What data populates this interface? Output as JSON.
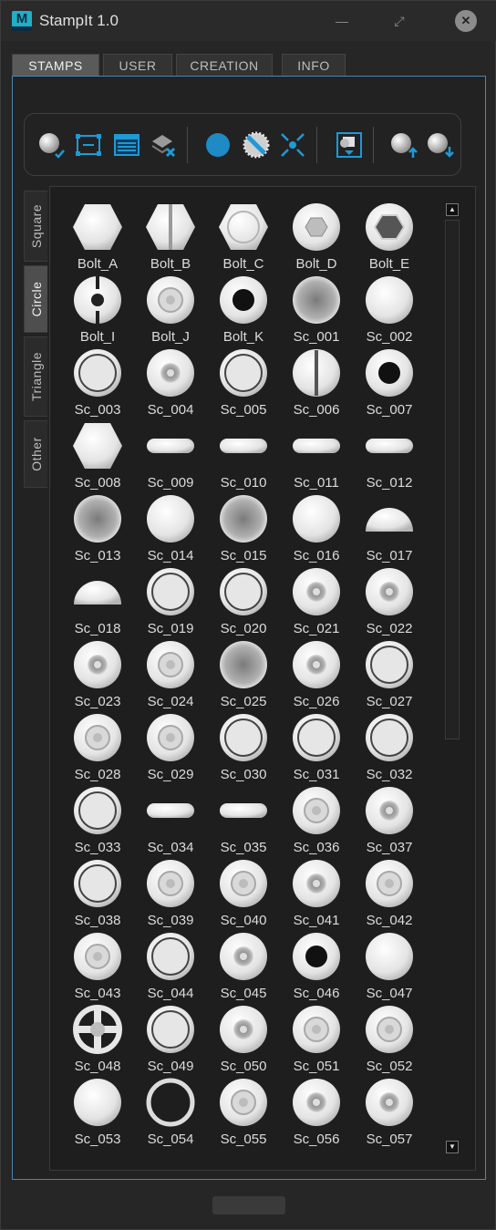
{
  "window": {
    "logo_letter": "M",
    "title": "StampIt 1.0",
    "minimize_glyph": "—",
    "maximize_glyph": "⤢",
    "close_glyph": "✕"
  },
  "tabs": [
    {
      "label": "STAMPS",
      "active": true
    },
    {
      "label": "USER",
      "active": false
    },
    {
      "label": "CREATION",
      "active": false
    },
    {
      "label": "INFO",
      "active": false
    }
  ],
  "toolbar": {
    "accent": "#1e9ad6",
    "icons": [
      "sphere-check-icon",
      "bounding-box-icon",
      "browser-window-icon",
      "layer-delete-icon",
      "circle-fill-icon",
      "circle-saw-icon",
      "cross-arrows-icon",
      "stamp-dropdown-icon",
      "sphere-up-icon",
      "sphere-down-icon"
    ]
  },
  "categories": [
    {
      "label": "Square",
      "active": false
    },
    {
      "label": "Circle",
      "active": true
    },
    {
      "label": "Triangle",
      "active": false
    },
    {
      "label": "Other",
      "active": false
    }
  ],
  "stamps": [
    {
      "name": "Bolt_A",
      "kind": "hex"
    },
    {
      "name": "Bolt_B",
      "kind": "hexslot"
    },
    {
      "name": "Bolt_C",
      "kind": "hexring"
    },
    {
      "name": "Bolt_D",
      "kind": "disc-hex"
    },
    {
      "name": "Bolt_E",
      "kind": "disc-hex-deep"
    },
    {
      "name": "Bolt_I",
      "kind": "disc-cut"
    },
    {
      "name": "Bolt_J",
      "kind": "disc-inner"
    },
    {
      "name": "Bolt_K",
      "kind": "disc-hole"
    },
    {
      "name": "Sc_001",
      "kind": "cup"
    },
    {
      "name": "Sc_002",
      "kind": "disc"
    },
    {
      "name": "Sc_003",
      "kind": "ring"
    },
    {
      "name": "Sc_004",
      "kind": "dimple"
    },
    {
      "name": "Sc_005",
      "kind": "ring"
    },
    {
      "name": "Sc_006",
      "kind": "slot"
    },
    {
      "name": "Sc_007",
      "kind": "disc-hole"
    },
    {
      "name": "Sc_008",
      "kind": "hex"
    },
    {
      "name": "Sc_009",
      "kind": "pill"
    },
    {
      "name": "Sc_010",
      "kind": "pill"
    },
    {
      "name": "Sc_011",
      "kind": "pill"
    },
    {
      "name": "Sc_012",
      "kind": "pill"
    },
    {
      "name": "Sc_013",
      "kind": "cup"
    },
    {
      "name": "Sc_014",
      "kind": "disc"
    },
    {
      "name": "Sc_015",
      "kind": "cup"
    },
    {
      "name": "Sc_016",
      "kind": "disc"
    },
    {
      "name": "Sc_017",
      "kind": "half"
    },
    {
      "name": "Sc_018",
      "kind": "half"
    },
    {
      "name": "Sc_019",
      "kind": "ring"
    },
    {
      "name": "Sc_020",
      "kind": "ring"
    },
    {
      "name": "Sc_021",
      "kind": "dimple"
    },
    {
      "name": "Sc_022",
      "kind": "dimple"
    },
    {
      "name": "Sc_023",
      "kind": "dimple"
    },
    {
      "name": "Sc_024",
      "kind": "disc-inner"
    },
    {
      "name": "Sc_025",
      "kind": "cup"
    },
    {
      "name": "Sc_026",
      "kind": "dimple"
    },
    {
      "name": "Sc_027",
      "kind": "ring"
    },
    {
      "name": "Sc_028",
      "kind": "disc-inner"
    },
    {
      "name": "Sc_029",
      "kind": "disc-inner"
    },
    {
      "name": "Sc_030",
      "kind": "ring"
    },
    {
      "name": "Sc_031",
      "kind": "ring"
    },
    {
      "name": "Sc_032",
      "kind": "ring"
    },
    {
      "name": "Sc_033",
      "kind": "ring"
    },
    {
      "name": "Sc_034",
      "kind": "pill"
    },
    {
      "name": "Sc_035",
      "kind": "pill"
    },
    {
      "name": "Sc_036",
      "kind": "disc-inner"
    },
    {
      "name": "Sc_037",
      "kind": "dimple"
    },
    {
      "name": "Sc_038",
      "kind": "ring"
    },
    {
      "name": "Sc_039",
      "kind": "disc-inner"
    },
    {
      "name": "Sc_040",
      "kind": "disc-inner"
    },
    {
      "name": "Sc_041",
      "kind": "dimple"
    },
    {
      "name": "Sc_042",
      "kind": "disc-inner"
    },
    {
      "name": "Sc_043",
      "kind": "disc-inner"
    },
    {
      "name": "Sc_044",
      "kind": "ring"
    },
    {
      "name": "Sc_045",
      "kind": "dimple"
    },
    {
      "name": "Sc_046",
      "kind": "disc-hole"
    },
    {
      "name": "Sc_047",
      "kind": "disc"
    },
    {
      "name": "Sc_048",
      "kind": "cross"
    },
    {
      "name": "Sc_049",
      "kind": "ring"
    },
    {
      "name": "Sc_050",
      "kind": "dimple"
    },
    {
      "name": "Sc_051",
      "kind": "disc-inner"
    },
    {
      "name": "Sc_052",
      "kind": "disc-inner"
    },
    {
      "name": "Sc_053",
      "kind": "disc"
    },
    {
      "name": "Sc_054",
      "kind": "ring-thin"
    },
    {
      "name": "Sc_055",
      "kind": "disc-inner"
    },
    {
      "name": "Sc_056",
      "kind": "dimple"
    },
    {
      "name": "Sc_057",
      "kind": "dimple"
    }
  ],
  "scrollbar": {
    "up_glyph": "▲",
    "down_glyph": "▼"
  }
}
